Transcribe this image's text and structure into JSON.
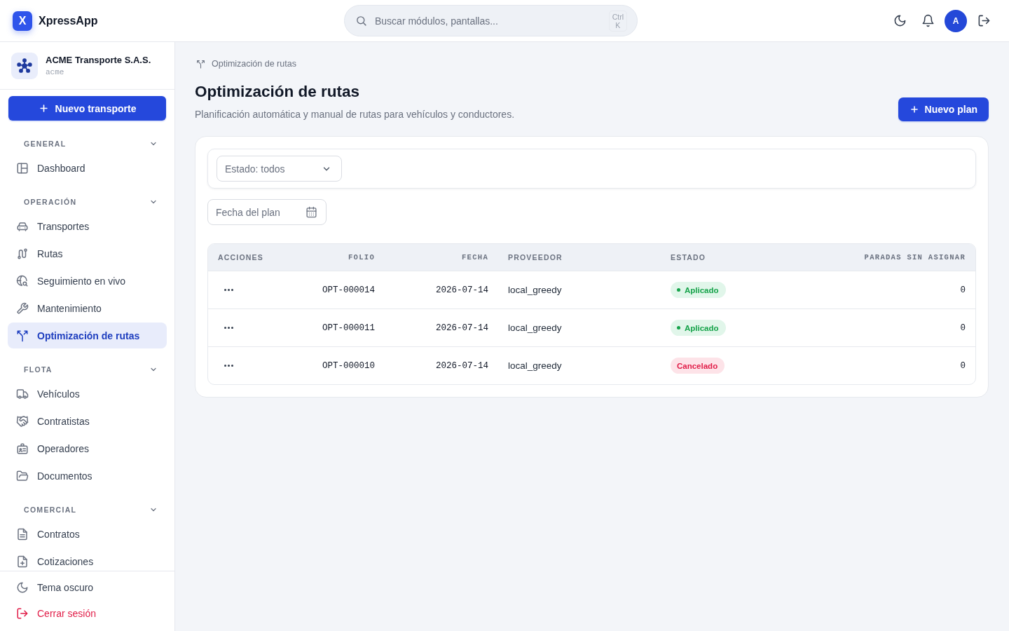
{
  "topbar": {
    "brand": {
      "mark": "X",
      "name": "XpressApp"
    },
    "search": {
      "placeholder": "Buscar módulos, pantallas...",
      "shortcut": "Ctrl K"
    },
    "avatar": {
      "initial": "A"
    }
  },
  "sidebar": {
    "organization": {
      "name": "ACME Transporte S.A.S.",
      "slug": "acme"
    },
    "primary_action": "Nuevo transporte",
    "sections": [
      {
        "title": "GENERAL",
        "expanded": true,
        "items": [
          {
            "label": "Dashboard",
            "selected": false
          }
        ]
      },
      {
        "title": "OPERACIÓN",
        "expanded": true,
        "items": [
          {
            "label": "Transportes",
            "selected": false
          },
          {
            "label": "Rutas",
            "selected": false
          },
          {
            "label": "Seguimiento en vivo",
            "selected": false
          },
          {
            "label": "Mantenimiento",
            "selected": false
          },
          {
            "label": "Optimización de rutas",
            "selected": true
          }
        ]
      },
      {
        "title": "FLOTA",
        "expanded": true,
        "items": [
          {
            "label": "Vehículos",
            "selected": false
          },
          {
            "label": "Contratistas",
            "selected": false
          },
          {
            "label": "Operadores",
            "selected": false
          },
          {
            "label": "Documentos",
            "selected": false
          }
        ]
      },
      {
        "title": "COMERCIAL",
        "expanded": true,
        "items": [
          {
            "label": "Contratos",
            "selected": false
          },
          {
            "label": "Cotizaciones",
            "selected": false
          }
        ]
      }
    ],
    "footer": [
      {
        "label": "Tema oscuro",
        "kind": "default"
      },
      {
        "label": "Cerrar sesión",
        "kind": "danger"
      }
    ]
  },
  "page": {
    "breadcrumb": "Optimización de rutas",
    "title": "Optimización de rutas",
    "subtitle": "Planificación automática y manual de rutas para vehículos y conductores.",
    "primary_action": "Nuevo plan"
  },
  "filters": {
    "status": {
      "value": "Estado: todos"
    },
    "date": {
      "placeholder": "Fecha del plan"
    }
  },
  "table": {
    "columns": [
      {
        "label": "ACCIONES",
        "kind": "actions"
      },
      {
        "label": "FOLIO",
        "kind": "mono"
      },
      {
        "label": "FECHA",
        "kind": "mono"
      },
      {
        "label": "PROVEEDOR",
        "kind": "text"
      },
      {
        "label": "ESTADO",
        "kind": "status"
      },
      {
        "label": "PARADAS SIN ASIGNAR",
        "kind": "mono"
      }
    ],
    "rows": [
      {
        "folio": "OPT-000014",
        "fecha": "2026-07-14",
        "proveedor": "local_greedy",
        "estado": {
          "label": "Aplicado",
          "kind": "success"
        },
        "paradas_sin_asignar": "0"
      },
      {
        "folio": "OPT-000011",
        "fecha": "2026-07-14",
        "proveedor": "local_greedy",
        "estado": {
          "label": "Aplicado",
          "kind": "success"
        },
        "paradas_sin_asignar": "0"
      },
      {
        "folio": "OPT-000010",
        "fecha": "2026-07-14",
        "proveedor": "local_greedy",
        "estado": {
          "label": "Cancelado",
          "kind": "danger"
        },
        "paradas_sin_asignar": "0"
      }
    ]
  }
}
